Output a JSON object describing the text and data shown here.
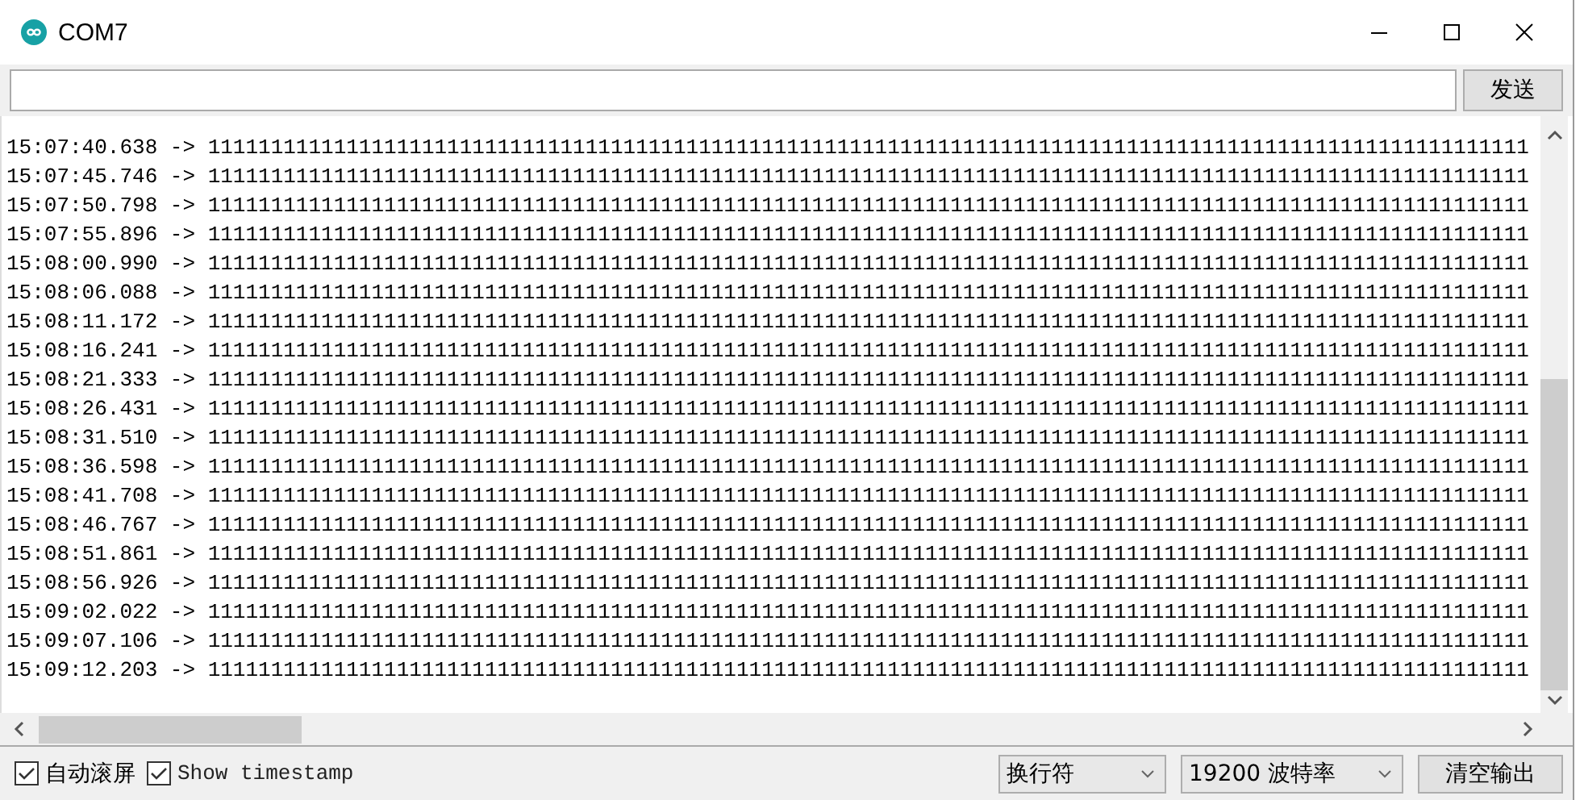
{
  "window": {
    "title": "COM7"
  },
  "send_button": "发送",
  "log_lines": [
    "15:07:40.638 -> 111111111111111111111111111111111111111111111111111111111111111111111111111111111111111111111111111111111",
    "15:07:45.746 -> 111111111111111111111111111111111111111111111111111111111111111111111111111111111111111111111111111111111",
    "15:07:50.798 -> 111111111111111111111111111111111111111111111111111111111111111111111111111111111111111111111111111111111",
    "15:07:55.896 -> 111111111111111111111111111111111111111111111111111111111111111111111111111111111111111111111111111111111",
    "15:08:00.990 -> 111111111111111111111111111111111111111111111111111111111111111111111111111111111111111111111111111111111",
    "15:08:06.088 -> 111111111111111111111111111111111111111111111111111111111111111111111111111111111111111111111111111111111",
    "15:08:11.172 -> 111111111111111111111111111111111111111111111111111111111111111111111111111111111111111111111111111111111",
    "15:08:16.241 -> 111111111111111111111111111111111111111111111111111111111111111111111111111111111111111111111111111111111",
    "15:08:21.333 -> 111111111111111111111111111111111111111111111111111111111111111111111111111111111111111111111111111111111",
    "15:08:26.431 -> 111111111111111111111111111111111111111111111111111111111111111111111111111111111111111111111111111111111",
    "15:08:31.510 -> 111111111111111111111111111111111111111111111111111111111111111111111111111111111111111111111111111111111",
    "15:08:36.598 -> 111111111111111111111111111111111111111111111111111111111111111111111111111111111111111111111111111111111",
    "15:08:41.708 -> 111111111111111111111111111111111111111111111111111111111111111111111111111111111111111111111111111111111",
    "15:08:46.767 -> 111111111111111111111111111111111111111111111111111111111111111111111111111111111111111111111111111111111",
    "15:08:51.861 -> 111111111111111111111111111111111111111111111111111111111111111111111111111111111111111111111111111111111",
    "15:08:56.926 -> 111111111111111111111111111111111111111111111111111111111111111111111111111111111111111111111111111111111",
    "15:09:02.022 -> 111111111111111111111111111111111111111111111111111111111111111111111111111111111111111111111111111111111",
    "15:09:07.106 -> 111111111111111111111111111111111111111111111111111111111111111111111111111111111111111111111111111111111",
    "15:09:12.203 -> 111111111111111111111111111111111111111111111111111111111111111111111111111111111111111111111111111111111"
  ],
  "options": [
    {
      "label": "自动滚屏",
      "checked": true
    },
    {
      "label": "Show timestamp",
      "checked": true,
      "kind": "mono"
    }
  ],
  "line_ending": "换行符",
  "baud_rate": "19200  波特率",
  "clear_button": "清空输出"
}
